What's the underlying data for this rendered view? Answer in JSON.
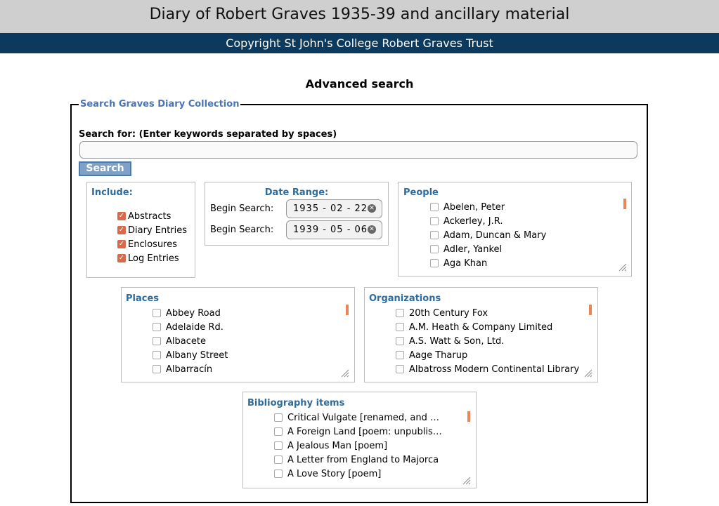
{
  "header": {
    "title": "Diary of Robert Graves 1935-39 and ancillary material"
  },
  "subheader": {
    "copyright": "Copyright St John's College Robert Graves Trust"
  },
  "page": {
    "heading": "Advanced search"
  },
  "form": {
    "legend": "Search Graves Diary Collection",
    "search_label": "Search for: (Enter keywords separated by spaces)",
    "search_value": "",
    "search_button": "Search"
  },
  "include": {
    "title": "Include:",
    "items": [
      {
        "label": "Abstracts",
        "checked": true
      },
      {
        "label": "Diary Entries",
        "checked": true
      },
      {
        "label": "Enclosures",
        "checked": true
      },
      {
        "label": "Log Entries",
        "checked": true
      }
    ]
  },
  "date_range": {
    "title": "Date Range:",
    "begin_label": "Begin Search:",
    "end_label": "Begin Search:",
    "begin_value": "1935 - 02 - 22",
    "end_value": "1939 - 05 - 06"
  },
  "people": {
    "title": "People",
    "items": [
      "Abelen, Peter",
      "Ackerley, J.R.",
      "Adam, Duncan & Mary",
      "Adler, Yankel",
      "Aga Khan"
    ]
  },
  "places": {
    "title": "Places",
    "items": [
      "Abbey Road",
      "Adelaide Rd.",
      "Albacete",
      "Albany Street",
      "Albarracín"
    ]
  },
  "organizations": {
    "title": "Organizations",
    "items": [
      "20th Century Fox",
      "A.M. Heath & Company Limited",
      "A.S. Watt & Son, Ltd.",
      "Aage Tharup",
      "Albatross Modern Continental Library"
    ]
  },
  "bibliography": {
    "title": "Bibliography items",
    "items": [
      "Critical Vulgate [renamed, and …",
      "A Foreign Land [poem: unpublis…",
      "A Jealous Man [poem]",
      "A Letter from England to Majorca",
      "A Love Story [poem]"
    ]
  },
  "colors": {
    "header_bg": "#cfcfcf",
    "subheader_bg": "#0b3a5e",
    "legend_text": "#4a74b4",
    "section_title": "#2e6c9e",
    "checkbox_checked": "#d8694a",
    "button_bg": "#7fa1c6"
  }
}
